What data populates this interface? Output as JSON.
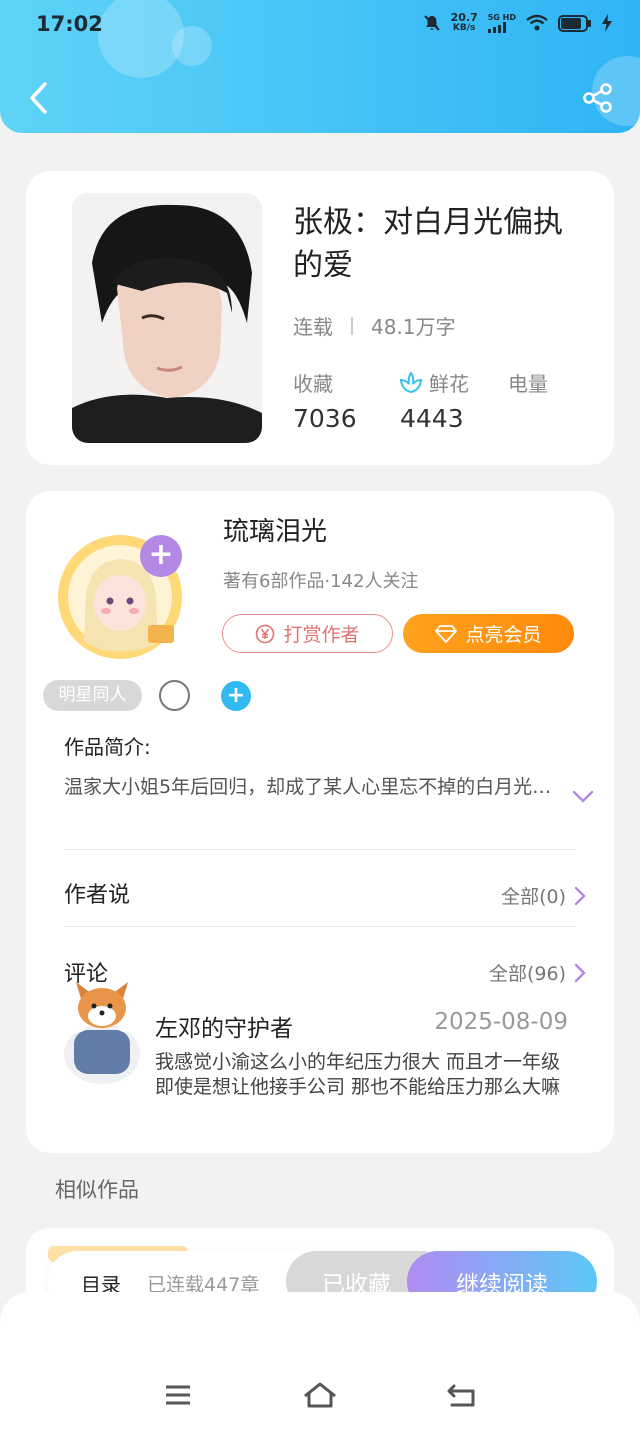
{
  "status_bar": {
    "time": "17:02",
    "net_speed": "20.7",
    "net_unit": "KB/s",
    "net_type": "5G HD"
  },
  "header": {
    "back_icon": "chevron-left-icon",
    "share_icon": "share-icon"
  },
  "book": {
    "title": "张极：对白月光偏执的爱",
    "status": "连载",
    "word_count": "48.1万字",
    "stats": {
      "favorites_label": "收藏",
      "favorites_value": "7036",
      "flowers_label": "鲜花",
      "flowers_value": "4443",
      "power_label": "电量"
    }
  },
  "author": {
    "name": "琉璃泪光",
    "sub": "著有6部作品·142人关注",
    "tip_label": "打赏作者",
    "vip_label": "点亮会员",
    "tag": "明星同人"
  },
  "intro": {
    "title": "作品简介:",
    "text": "温家大小姐5年后回归，却成了某人心里忘不掉的白月光…"
  },
  "author_says": {
    "title": "作者说",
    "more": "全部(0)"
  },
  "comments": {
    "title": "评论",
    "more": "全部(96)",
    "items": [
      {
        "user": "左邓的守护者",
        "date": "2025-08-09",
        "text": "我感觉小渝这么小的年纪压力很大 而且才一年级 即使是想让他接手公司 那也不能给压力那么大嘛"
      }
    ]
  },
  "similar": {
    "title": "相似作品"
  },
  "bottom_bar": {
    "toc": "目录",
    "chapters": "已连载447章",
    "favorited": "已收藏",
    "continue": "继续阅读"
  },
  "nav": {
    "menu_icon": "menu-icon",
    "home_icon": "home-icon",
    "back_icon": "back-icon"
  },
  "colors": {
    "header": "#2fb4f5",
    "accent_orange": "#ff9514",
    "accent_purple": "#b489e6",
    "accent_blue": "#31b9f0"
  }
}
